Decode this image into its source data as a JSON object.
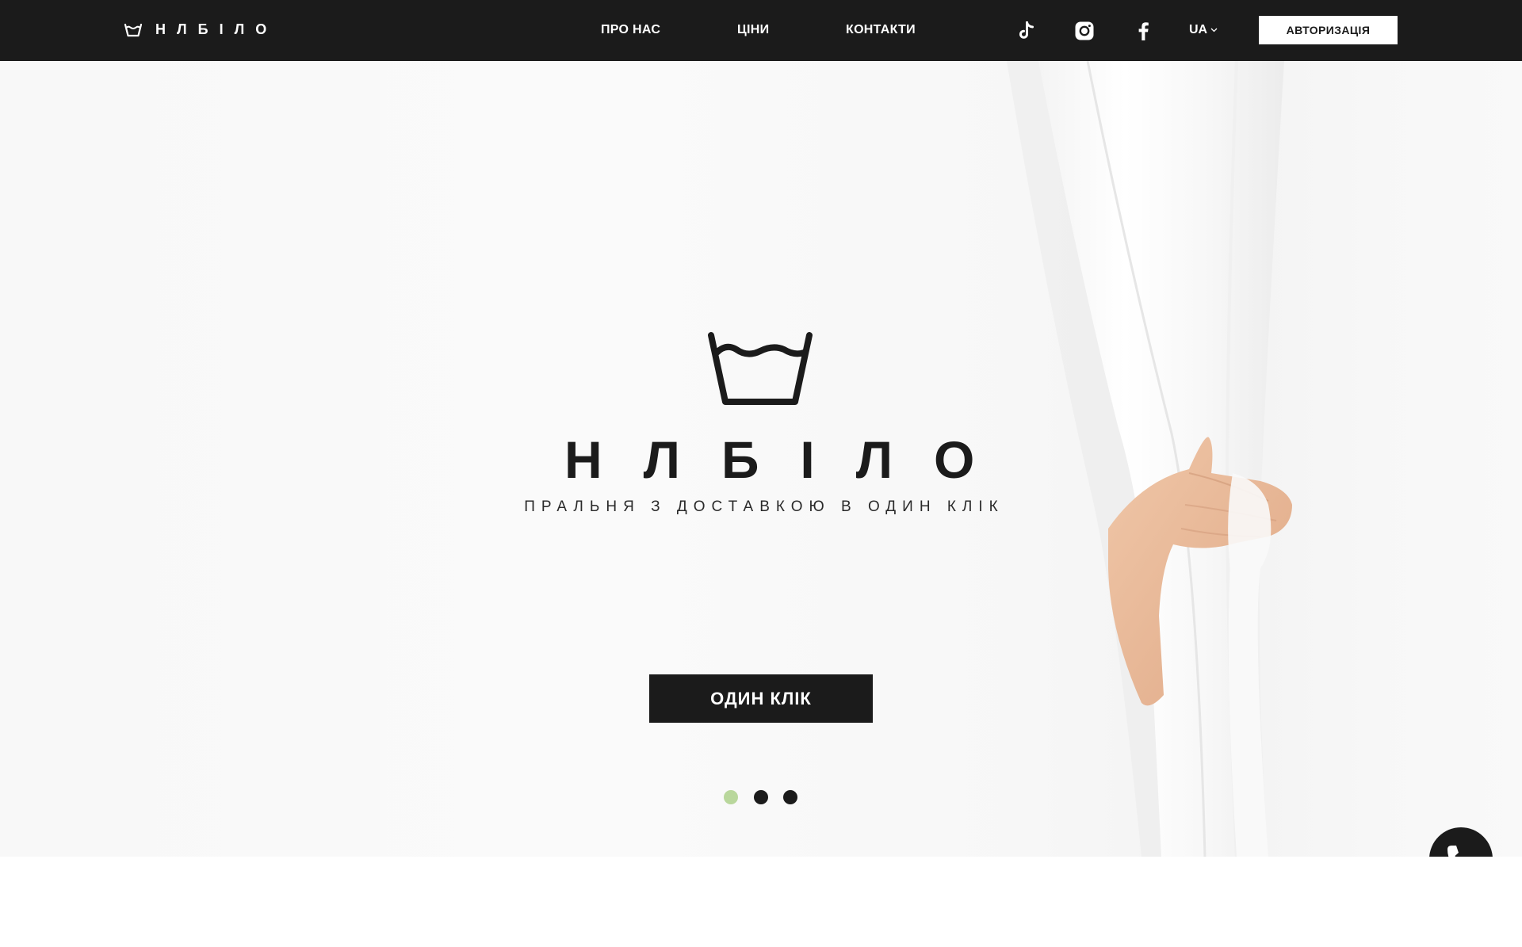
{
  "header": {
    "brand_name": "НЛБІЛО",
    "nav": {
      "about": "ПРО НАС",
      "prices": "ЦІНИ",
      "contacts": "КОНТАКТИ"
    },
    "socials": [
      "tiktok-icon",
      "instagram-icon",
      "facebook-icon"
    ],
    "language": "UA",
    "auth_label": "АВТОРИЗАЦІЯ"
  },
  "hero": {
    "title": "НЛБІЛО",
    "tagline": "ПРАЛЬНЯ З ДОСТАВКОЮ В ОДИН КЛІК",
    "cta_label": "ОДИН КЛІК",
    "slides": {
      "count": 3,
      "active": 1
    }
  },
  "floating": {
    "call_icon": "phone-icon"
  },
  "colors": {
    "header_bg": "#1b1b1b",
    "text_dark": "#1b1b1b",
    "active_dot": "#b9d79c",
    "inactive_dot": "#1b1b1b",
    "white": "#ffffff"
  }
}
